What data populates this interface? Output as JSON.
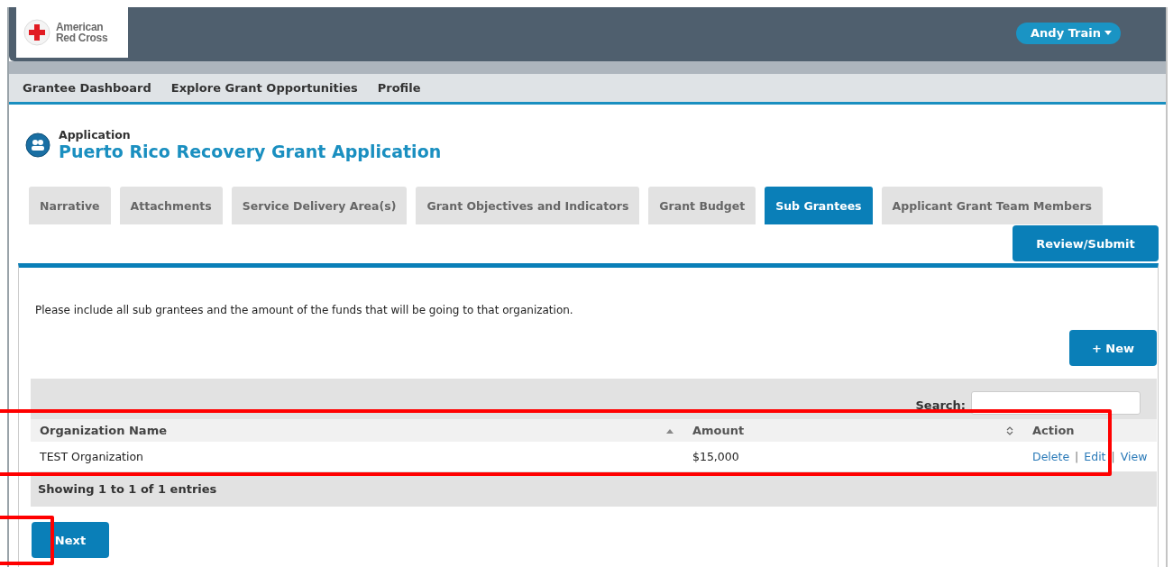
{
  "header": {
    "logo_text": [
      "American",
      "Red Cross"
    ],
    "user_menu": "Andy Train"
  },
  "nav": [
    "Grantee Dashboard",
    "Explore Grant Opportunities",
    "Profile"
  ],
  "page": {
    "kicker": "Application",
    "title": "Puerto Rico Recovery Grant Application"
  },
  "tabs": [
    {
      "label": "Narrative",
      "selected": false
    },
    {
      "label": "Attachments",
      "selected": false
    },
    {
      "label": "Service Delivery Area(s)",
      "selected": false
    },
    {
      "label": "Grant Objectives and Indicators",
      "selected": false
    },
    {
      "label": "Grant Budget",
      "selected": false
    },
    {
      "label": "Sub Grantees",
      "selected": true
    },
    {
      "label": "Applicant Grant Team Members",
      "selected": false
    }
  ],
  "review_button": "Review/Submit",
  "instructions": "Please include all sub grantees and the amount of the funds that will be going to that organization.",
  "new_button": "+ New",
  "table": {
    "search_label": "Search:",
    "columns": [
      {
        "label": "Organization Name",
        "sortable": true,
        "sorted": true
      },
      {
        "label": "Amount",
        "sortable": true,
        "sorted": false
      },
      {
        "label": "Action",
        "sortable": false,
        "sorted": false
      }
    ],
    "rows": [
      {
        "name": "TEST Organization",
        "amount": "$15,000",
        "actions": [
          "Delete",
          "Edit",
          "View"
        ],
        "separator": "|"
      }
    ],
    "info": "Showing 1 to 1 of 1 entries"
  },
  "next_button": "Next",
  "annotations": [
    {
      "kind": "highlight"
    },
    {
      "kind": "highlight"
    }
  ]
}
